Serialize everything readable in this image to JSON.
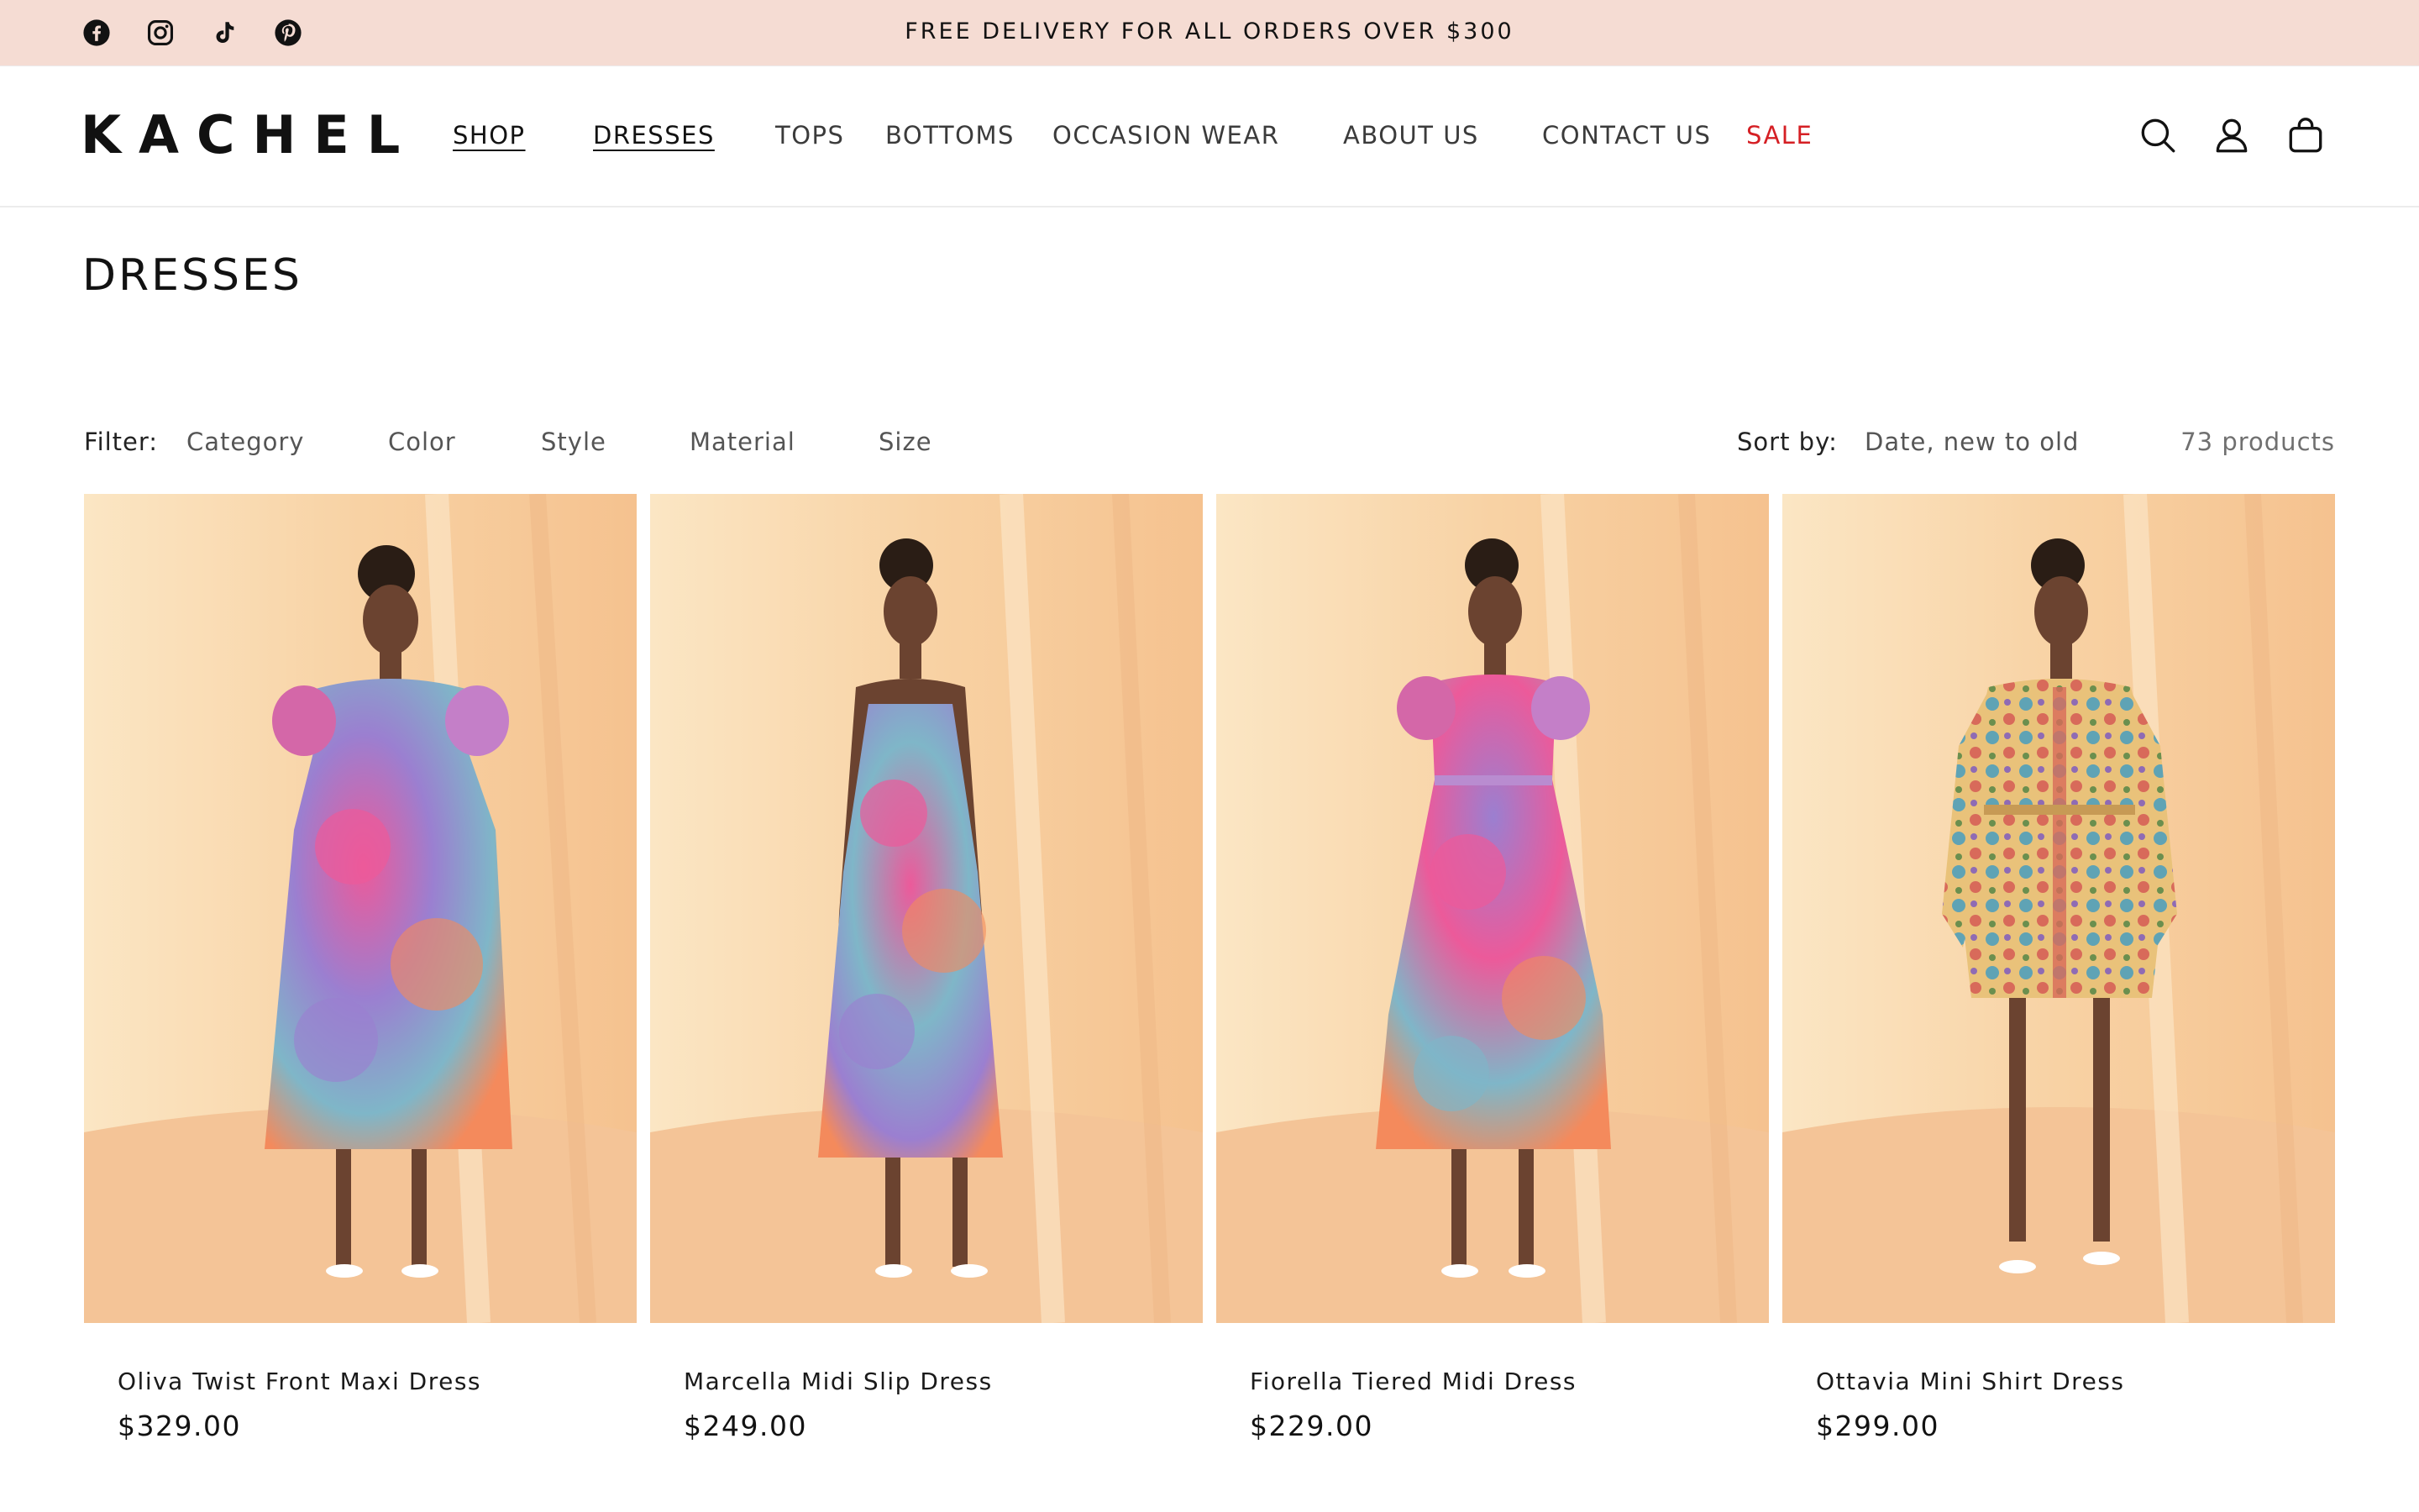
{
  "announcement": {
    "text": "FREE DELIVERY FOR ALL ORDERS OVER $300",
    "social": [
      "facebook-icon",
      "instagram-icon",
      "tiktok-icon",
      "pinterest-icon"
    ]
  },
  "header": {
    "logo": "KACHEL",
    "nav": [
      {
        "label": "SHOP"
      },
      {
        "label": "DRESSES"
      },
      {
        "label": "TOPS"
      },
      {
        "label": "BOTTOMS"
      },
      {
        "label": "OCCASION WEAR"
      },
      {
        "label": "ABOUT US"
      },
      {
        "label": "CONTACT US"
      },
      {
        "label": "SALE"
      }
    ],
    "icons": [
      "search-icon",
      "account-icon",
      "cart-icon"
    ]
  },
  "page": {
    "title": "DRESSES"
  },
  "filters": {
    "label": "Filter:",
    "options": [
      "Category",
      "Color",
      "Style",
      "Material",
      "Size"
    ],
    "sort_label": "Sort by:",
    "sort_value": "Date, new to old",
    "count": "73 products"
  },
  "products": [
    {
      "name": "Oliva Twist Front Maxi Dress",
      "price": "$329.00"
    },
    {
      "name": "Marcella Midi Slip Dress",
      "price": "$249.00"
    },
    {
      "name": "Fiorella Tiered Midi Dress",
      "price": "$229.00"
    },
    {
      "name": "Ottavia Mini Shirt Dress",
      "price": "$299.00"
    }
  ],
  "colors": {
    "announcement_bg": "#f5dcd3",
    "sale": "#d51f24",
    "backdrop": "#f6c99a",
    "floral_pink": "#ec5a9a",
    "floral_purple": "#9b7fd0",
    "floral_teal": "#7fb6c8"
  }
}
